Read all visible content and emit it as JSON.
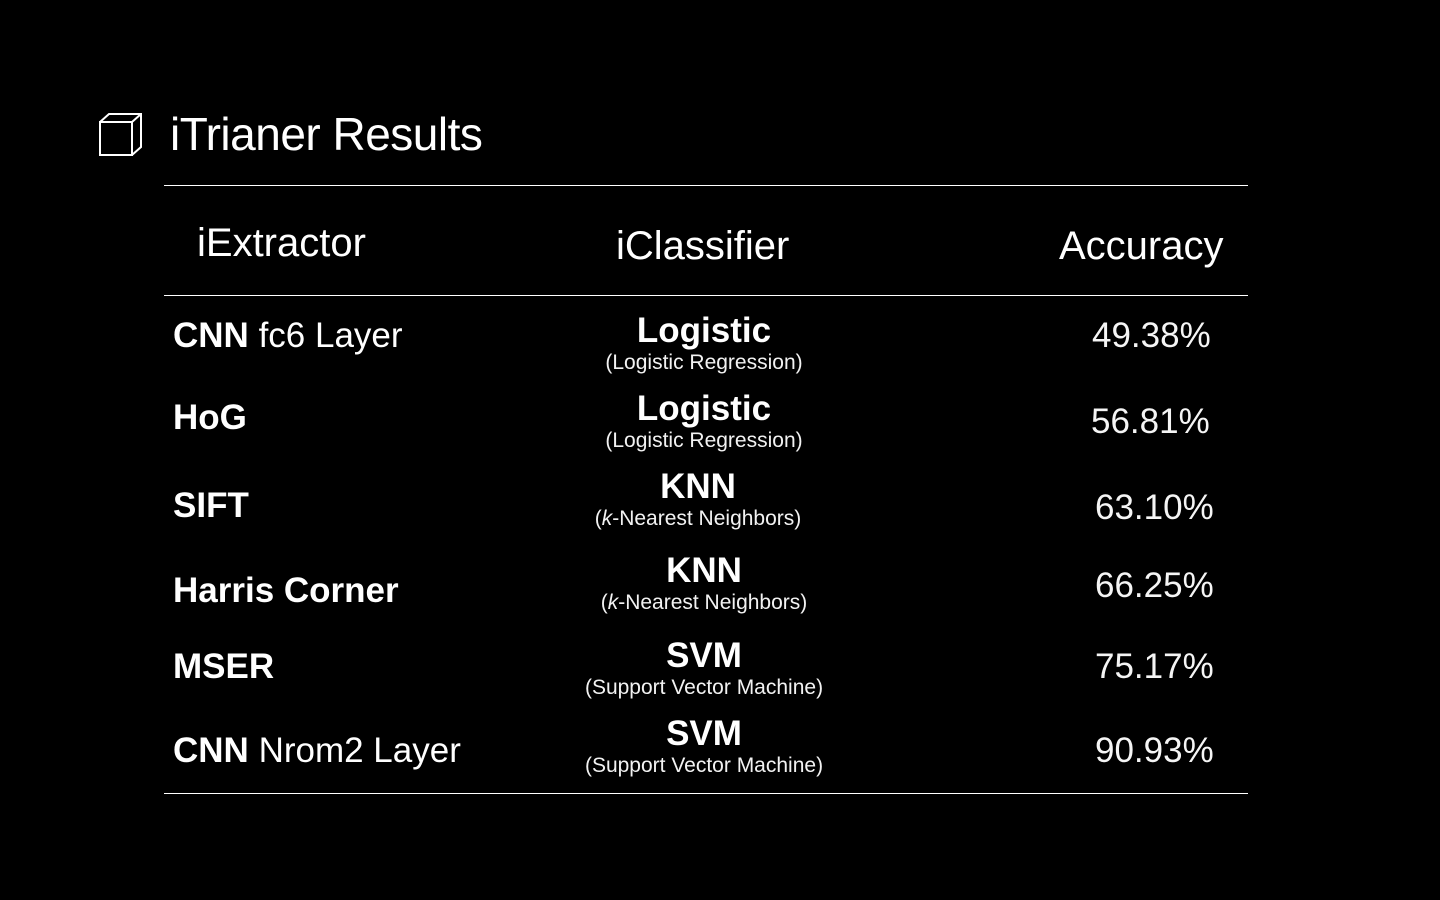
{
  "title": "iTrianer Results",
  "icon": "cube-icon",
  "headers": {
    "extractor": "iExtractor",
    "classifier": "iClassifier",
    "accuracy": "Accuracy"
  },
  "rows": [
    {
      "extractor": "CNN",
      "extractor_detail": "fc6 Layer",
      "classifier": "Logistic",
      "classifier_full_prefix": "(",
      "classifier_full_k": "",
      "classifier_full_rest": "Logistic Regression)",
      "accuracy": "49.38%"
    },
    {
      "extractor": "HoG",
      "extractor_detail": "",
      "classifier": "Logistic",
      "classifier_full_prefix": "(",
      "classifier_full_k": "",
      "classifier_full_rest": "Logistic Regression)",
      "accuracy": "56.81%"
    },
    {
      "extractor": "SIFT",
      "extractor_detail": "",
      "classifier": "KNN",
      "classifier_full_prefix": "(",
      "classifier_full_k": "k",
      "classifier_full_rest": "-Nearest Neighbors)",
      "accuracy": "63.10%"
    },
    {
      "extractor": "Harris Corner",
      "extractor_detail": "",
      "classifier": "KNN",
      "classifier_full_prefix": "(",
      "classifier_full_k": "k",
      "classifier_full_rest": "-Nearest Neighbors)",
      "accuracy": "66.25%"
    },
    {
      "extractor": "MSER",
      "extractor_detail": "",
      "classifier": "SVM",
      "classifier_full_prefix": "(",
      "classifier_full_k": "",
      "classifier_full_rest": "Support Vector Machine)",
      "accuracy": "75.17%"
    },
    {
      "extractor": "CNN",
      "extractor_detail": "Nrom2 Layer",
      "classifier": "SVM",
      "classifier_full_prefix": "(",
      "classifier_full_k": "",
      "classifier_full_rest": "Support Vector Machine)",
      "accuracy": "90.93%"
    }
  ]
}
